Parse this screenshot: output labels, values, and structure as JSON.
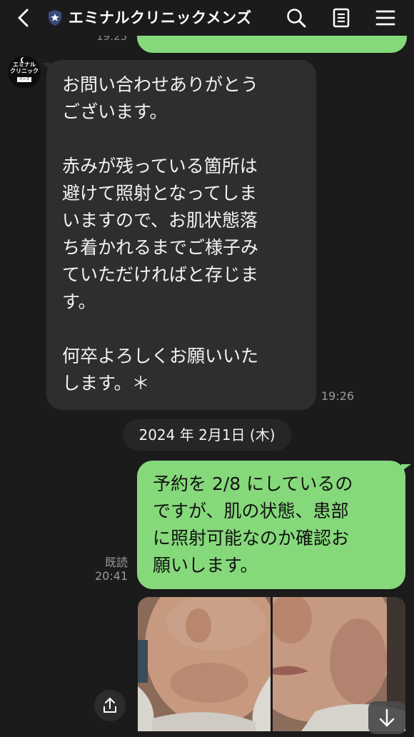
{
  "header": {
    "title": "エミナルクリニックメンズ",
    "icons": [
      "back-icon",
      "shield-star-icon",
      "search-icon",
      "note-icon",
      "menu-icon"
    ]
  },
  "chat": {
    "previous_time": "19:25",
    "avatar": {
      "line1": "エミナル",
      "line2": "クリニック",
      "line3": "メンズ"
    },
    "incoming": {
      "text": "お問い合わせありがとう\nございます。\n\n赤みが残っている箇所は\n避けて照射となってしま\nいますので、お肌状態落\nち着かれるまでご様子み\nていただければと存じま\nす。\n\n何卒よろしくお願いいた\nします。＊",
      "time": "19:26"
    },
    "date_separator": "2024 年 2月1日 (木)",
    "outgoing": {
      "text": "予約を 2/8 にしているの\nですが、肌の状態、患部\nに照射可能なのか確認お\n願いします。",
      "read_label": "既読",
      "time": "20:41"
    },
    "photos": [
      "face-front-photo",
      "face-side-photo"
    ]
  },
  "colors": {
    "background": "#1b1b1b",
    "incoming_bubble": "#2e2e2e",
    "outgoing_bubble": "#86d97b",
    "meta_text": "#9a9a9a"
  }
}
